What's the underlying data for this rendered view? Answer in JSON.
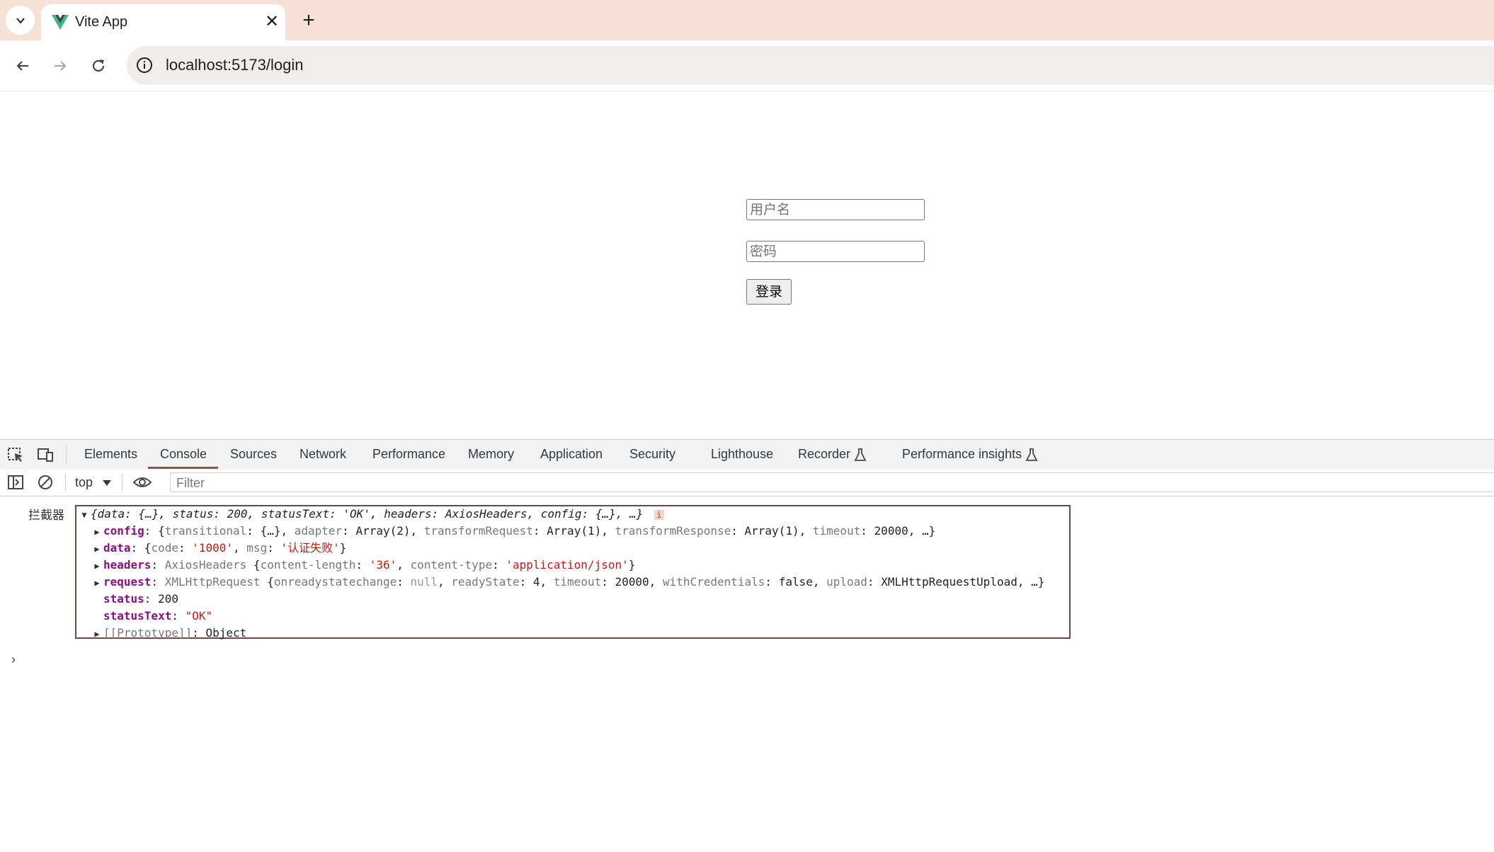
{
  "browser": {
    "tab_title": "Vite App",
    "url": "localhost:5173/login",
    "icons": {
      "tab_menu": "chevron-down-icon",
      "favicon": "vue-logo-icon",
      "close": "close-icon",
      "new_tab": "plus-icon",
      "back": "back-arrow-icon",
      "forward": "forward-arrow-icon",
      "reload": "reload-icon",
      "site_info": "info-icon"
    },
    "new_tab_glyph": "+",
    "close_glyph": "✕"
  },
  "login": {
    "username_placeholder": "用户名",
    "password_placeholder": "密码",
    "button_label": "登录"
  },
  "devtools": {
    "tabs": [
      "Elements",
      "Console",
      "Sources",
      "Network",
      "Performance",
      "Memory",
      "Application",
      "Security",
      "Lighthouse",
      "Recorder",
      "Performance insights"
    ],
    "active_tab": "Console",
    "context": "top",
    "filter_placeholder": "Filter",
    "log_prefix": "拦截器",
    "summary": "{data: {…}, status: 200, statusText: 'OK', headers: AxiosHeaders, config: {…}, …}",
    "info_badge": "i",
    "lines": {
      "config": {
        "key": "config",
        "p1": "transitional",
        "v1": "{…}",
        "p2": "adapter",
        "v2": "Array(2)",
        "p3": "transformRequest",
        "v3": "Array(1)",
        "p4": "transformResponse",
        "v4": "Array(1)",
        "p5": "timeout",
        "v5": "20000",
        "tail": ", …}"
      },
      "data": {
        "key": "data",
        "p1": "code",
        "v1": "'1000'",
        "p2": "msg",
        "v2": "'认证失败'"
      },
      "headers": {
        "key": "headers",
        "type": "AxiosHeaders",
        "p1": "content-length",
        "v1": "'36'",
        "p2": "content-type",
        "v2": "'application/json'"
      },
      "request": {
        "key": "request",
        "type": "XMLHttpRequest",
        "p1": "onreadystatechange",
        "v1": "null",
        "p2": "readyState",
        "v2": "4",
        "p3": "timeout",
        "v3": "20000",
        "p4": "withCredentials",
        "v4": "false",
        "p5": "upload",
        "v5": "XMLHttpRequestUpload",
        "tail": ", …}"
      },
      "status": {
        "key": "status",
        "value": "200"
      },
      "statusText": {
        "key": "statusText",
        "value": "\"OK\""
      },
      "prototype": {
        "key": "[[Prototype]]",
        "value": "Object"
      }
    },
    "prompt_glyph": "›",
    "colors": {
      "tab_strip": "#f7e1d7",
      "active_underline": "#7b5e52",
      "object_border": "#6a4b45",
      "key_purple": "#881280",
      "string_red": "#c41a16"
    }
  }
}
